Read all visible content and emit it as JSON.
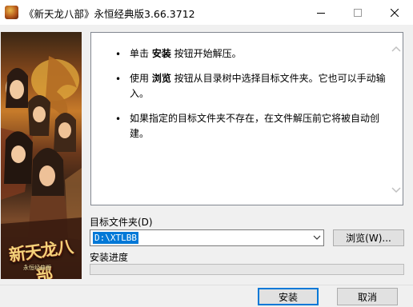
{
  "window": {
    "title": "《新天龙八部》永恒经典版3.66.3712"
  },
  "banner": {
    "logo_text": "新天龙八部",
    "logo_subtext": "永恒经典版"
  },
  "info": {
    "items": [
      {
        "pre": "单击 ",
        "bold": "安装",
        "post": " 按钮开始解压。"
      },
      {
        "pre": "使用 ",
        "bold": "浏览",
        "post": " 按钮从目录树中选择目标文件夹。它也可以手动输入。"
      },
      {
        "pre": "",
        "bold": "",
        "post": "如果指定的目标文件夹不存在，在文件解压前它将被自动创建。"
      }
    ]
  },
  "target_folder": {
    "label": "目标文件夹(D)",
    "value": "D:\\XTLBB"
  },
  "browse_button": "浏览(W)...",
  "progress": {
    "label": "安装进度",
    "fraction": 0
  },
  "install_button": "安装",
  "cancel_button": "取消",
  "icons": {
    "minimize": "minimize-icon",
    "maximize": "maximize-icon",
    "close": "close-icon"
  }
}
